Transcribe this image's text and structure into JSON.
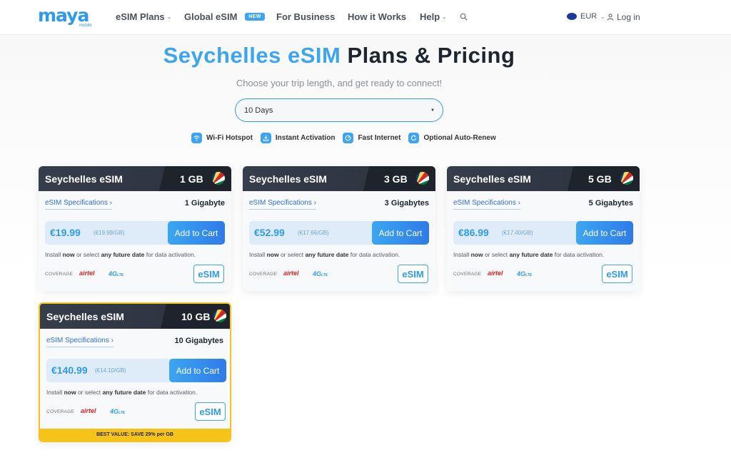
{
  "nav": {
    "logo_text": "maya",
    "logo_sub": "mobile",
    "items": [
      {
        "label": "eSIM Plans"
      },
      {
        "label": "Global eSIM",
        "badge": "NEW"
      },
      {
        "label": "For Business"
      },
      {
        "label": "How it Works"
      },
      {
        "label": "Help"
      }
    ],
    "currency": "EUR",
    "login": "Log in"
  },
  "hero": {
    "title_highlight": "Seychelles eSIM",
    "title_rest": "Plans & Pricing",
    "subtitle": "Choose your trip length, and get ready to connect!",
    "select_value": "10 Days"
  },
  "features": [
    {
      "label": "Wi-Fi Hotspot",
      "icon": "wifi-icon"
    },
    {
      "label": "Instant Activation",
      "icon": "download-icon"
    },
    {
      "label": "Fast Internet",
      "icon": "speed-icon"
    },
    {
      "label": "Optional Auto-Renew",
      "icon": "renew-icon"
    }
  ],
  "plans": [
    {
      "name": "Seychelles eSIM",
      "gb": "1 GB",
      "gb_full": "1 Gigabyte",
      "spec_link": "eSIM Specifications ›",
      "price": "€19.99",
      "per_gb": "(€19.99/GB)",
      "cart": "Add to Cart",
      "coverage": "COVERAGE",
      "carrier": "airtel",
      "network": "4G",
      "network_sub": "LTE",
      "esim": "eSIM"
    },
    {
      "name": "Seychelles eSIM",
      "gb": "3 GB",
      "gb_full": "3 Gigabytes",
      "spec_link": "eSIM Specifications ›",
      "price": "€52.99",
      "per_gb": "(€17.66/GB)",
      "cart": "Add to Cart",
      "coverage": "COVERAGE",
      "carrier": "airtel",
      "network": "4G",
      "network_sub": "LTE",
      "esim": "eSIM"
    },
    {
      "name": "Seychelles eSIM",
      "gb": "5 GB",
      "gb_full": "5 Gigabytes",
      "spec_link": "eSIM Specifications ›",
      "price": "€86.99",
      "per_gb": "(€17.40/GB)",
      "cart": "Add to Cart",
      "coverage": "COVERAGE",
      "carrier": "airtel",
      "network": "4G",
      "network_sub": "LTE",
      "esim": "eSIM"
    },
    {
      "name": "Seychelles eSIM",
      "gb": "10 GB",
      "gb_full": "10 Gigabytes",
      "spec_link": "eSIM Specifications ›",
      "price": "€140.99",
      "per_gb": "(€14.10/GB)",
      "cart": "Add to Cart",
      "coverage": "COVERAGE",
      "carrier": "airtel",
      "network": "4G",
      "network_sub": "LTE",
      "esim": "eSIM",
      "best_value": "BEST VALUE: SAVE 29% per GB"
    }
  ],
  "install_text": {
    "pre": "Install ",
    "now": "now",
    "mid": " or select ",
    "future": "any future date",
    "post": " for data activation."
  },
  "colors": {
    "brand_blue": "#2f9be8",
    "card_header": "#2b313d",
    "best_value": "#f6c31a",
    "carrier_red": "#e21f26"
  }
}
